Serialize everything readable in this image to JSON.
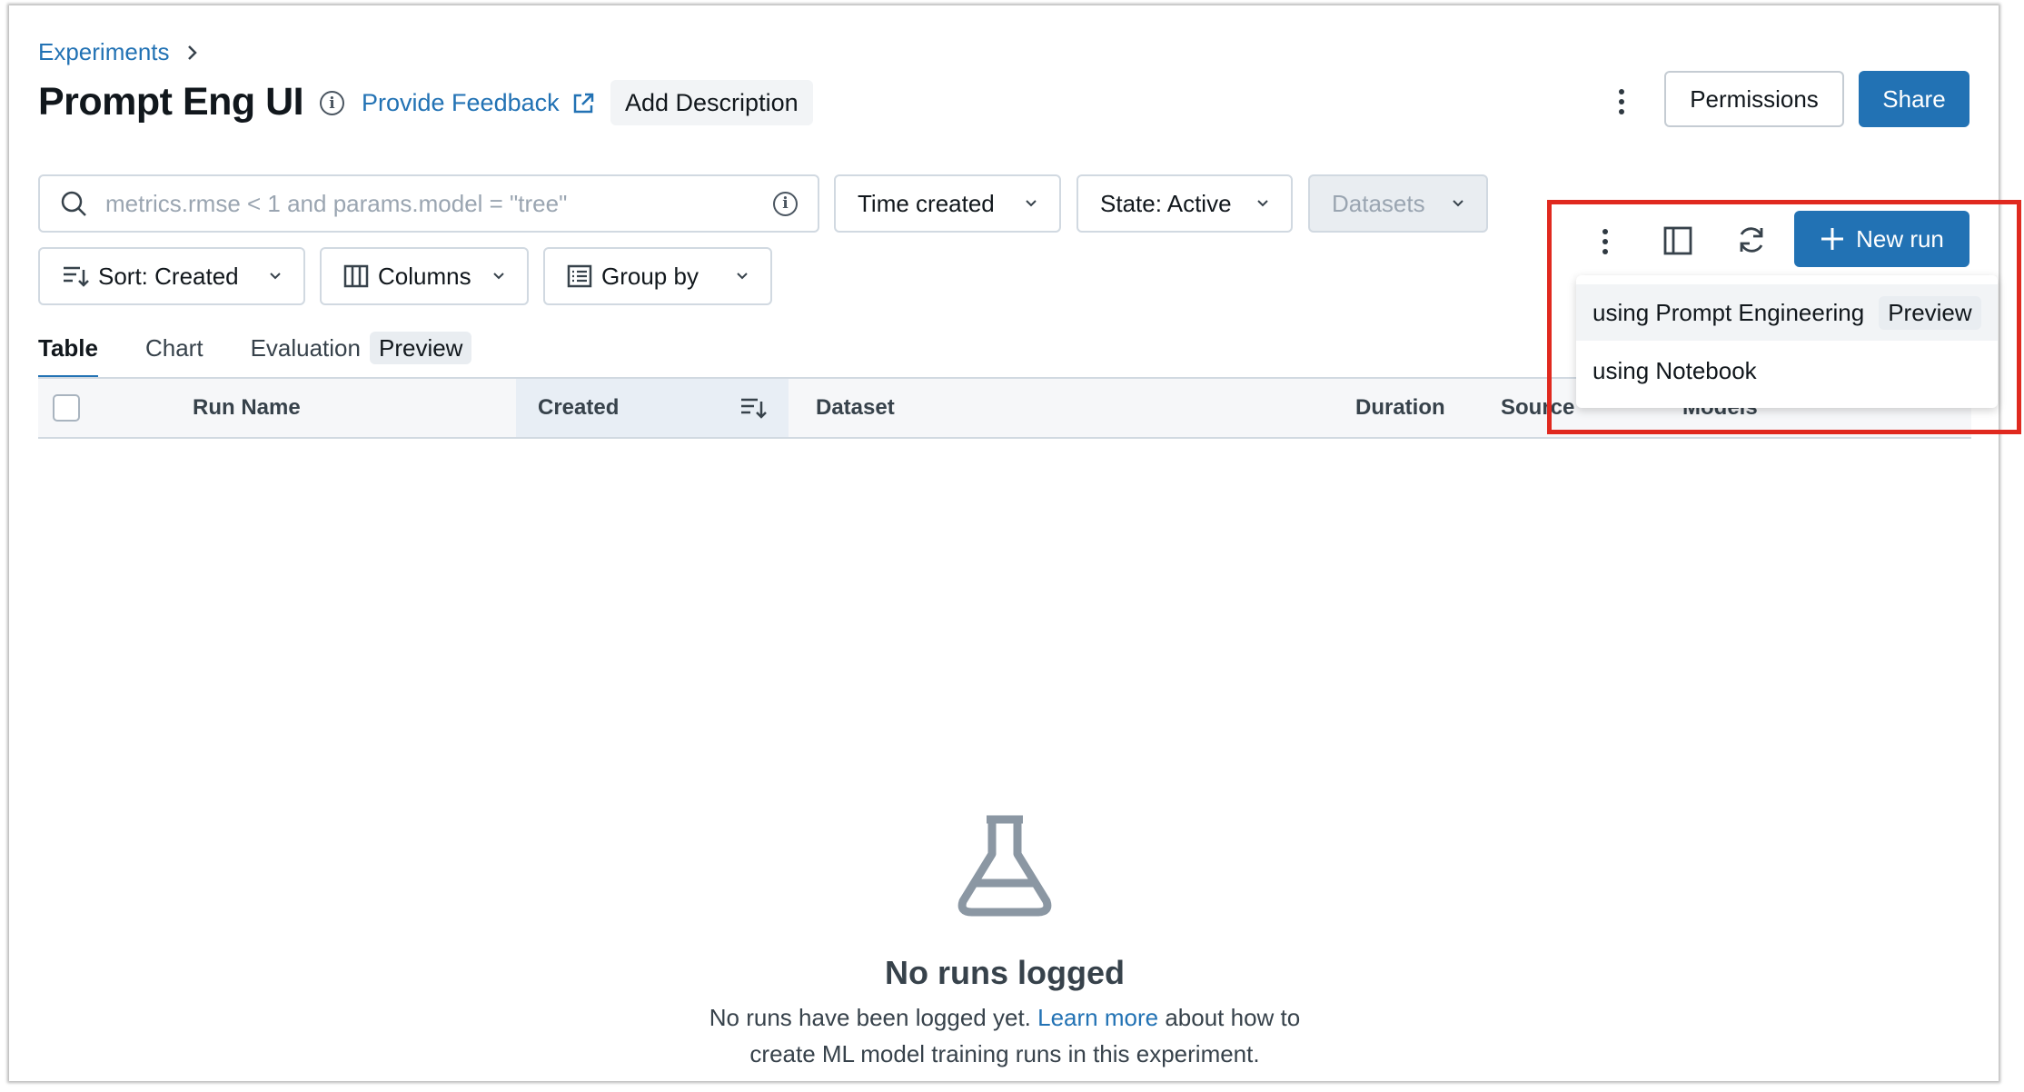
{
  "breadcrumb": {
    "label": "Experiments"
  },
  "header": {
    "title": "Prompt Eng UI",
    "feedback_label": "Provide Feedback",
    "add_description_label": "Add Description",
    "permissions_label": "Permissions",
    "share_label": "Share"
  },
  "filters": {
    "search_placeholder": "metrics.rmse < 1 and params.model = \"tree\"",
    "time_created": "Time created",
    "state": "State: Active",
    "datasets": "Datasets",
    "sort": "Sort: Created",
    "columns": "Columns",
    "group_by": "Group by"
  },
  "tabs": [
    {
      "label": "Table",
      "active": true
    },
    {
      "label": "Chart"
    },
    {
      "label": "Evaluation",
      "badge": "Preview"
    }
  ],
  "table": {
    "columns": [
      "Run Name",
      "Created",
      "Dataset",
      "Duration",
      "Source",
      "Models"
    ]
  },
  "toolbar": {
    "new_run_label": "New run"
  },
  "new_run_menu": {
    "items": [
      {
        "label": "using Prompt Engineering",
        "badge": "Preview"
      },
      {
        "label": "using Notebook"
      }
    ]
  },
  "empty_state": {
    "title": "No runs logged",
    "text_before": "No runs have been logged yet.",
    "link": "Learn more",
    "text_after": "about how to",
    "text_line2": "create ML model training runs in this experiment."
  },
  "colors": {
    "primary": "#2272b4",
    "highlight": "#e0291f"
  }
}
